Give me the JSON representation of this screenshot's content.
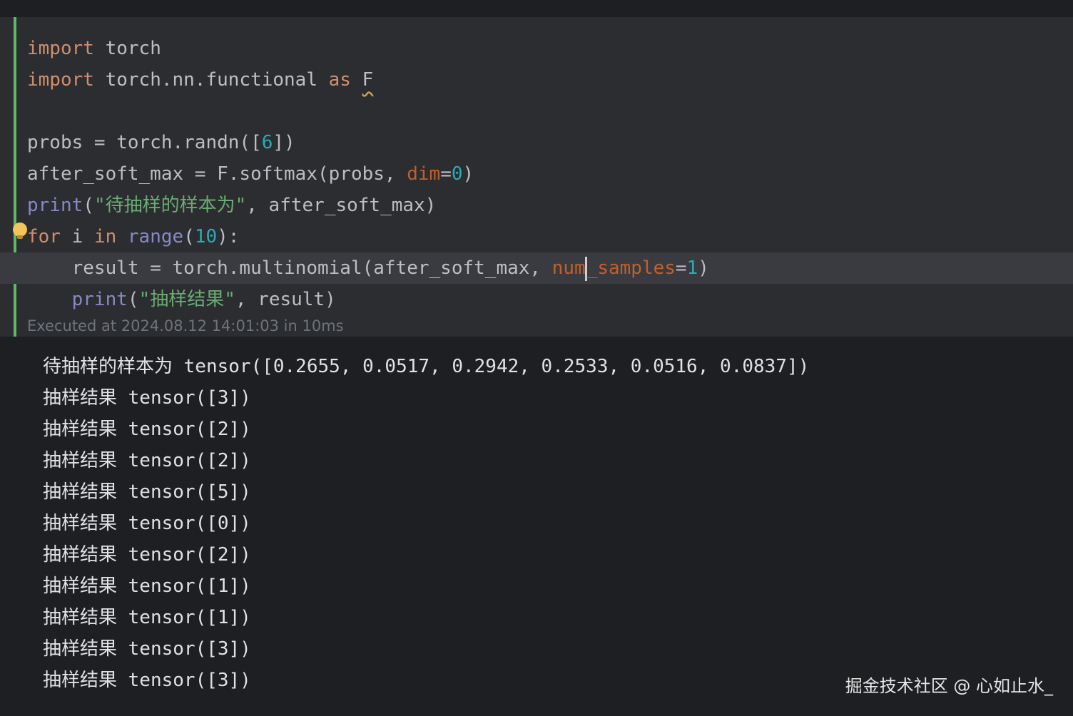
{
  "editor": {
    "code_tokens": {
      "l1_import": "import",
      "l1_rest": " torch",
      "l2_import": "import",
      "l2_mid": " torch.nn.functional ",
      "l2_as": "as",
      "l2_space": " ",
      "l2_alias": "F",
      "l4": "probs = torch.randn([",
      "l4_num": "6",
      "l4_end": "])",
      "l5_a": "after_soft_max = F.softmax(probs, ",
      "l5_param": "dim",
      "l5_eq": "=",
      "l5_num": "0",
      "l5_end": ")",
      "l6_fn": "print",
      "l6_open": "(",
      "l6_str": "\"待抽样的样本为\"",
      "l6_rest": ", after_soft_max)",
      "l7_for": "for",
      "l7_i": " i ",
      "l7_in": "in",
      "l7_sp": " ",
      "l7_range": "range",
      "l7_open": "(",
      "l7_num": "10",
      "l7_end": "):",
      "l8_indent": "    ",
      "l8_a": "result = torch.multinomial(after_soft_max, ",
      "l8_param1": "num",
      "l8_param2": "_samples",
      "l8_eq": "=",
      "l8_num": "1",
      "l8_end": ")",
      "l9_indent": "    ",
      "l9_fn": "print",
      "l9_open": "(",
      "l9_str": "\"抽样结果\"",
      "l9_rest": ", result)"
    },
    "execution_info": "Executed at 2024.08.12 14:01:03 in 10ms"
  },
  "output": {
    "lines": [
      "待抽样的样本为 tensor([0.2655, 0.0517, 0.2942, 0.2533, 0.0516, 0.0837])",
      "抽样结果 tensor([3])",
      "抽样结果 tensor([2])",
      "抽样结果 tensor([2])",
      "抽样结果 tensor([5])",
      "抽样结果 tensor([0])",
      "抽样结果 tensor([2])",
      "抽样结果 tensor([1])",
      "抽样结果 tensor([1])",
      "抽样结果 tensor([3])",
      "抽样结果 tensor([3])"
    ]
  },
  "watermark": "掘金技术社区 @ 心如止水_",
  "colors": {
    "background": "#1e1f22",
    "cell_background": "#2b2d30",
    "cell_indicator": "#5fb865",
    "keyword": "#cf8e6d",
    "number": "#2aacb8",
    "builtin": "#8888c6",
    "string": "#6aab73",
    "parameter": "#c0602a"
  },
  "icons": [
    "lightbulb-icon"
  ]
}
